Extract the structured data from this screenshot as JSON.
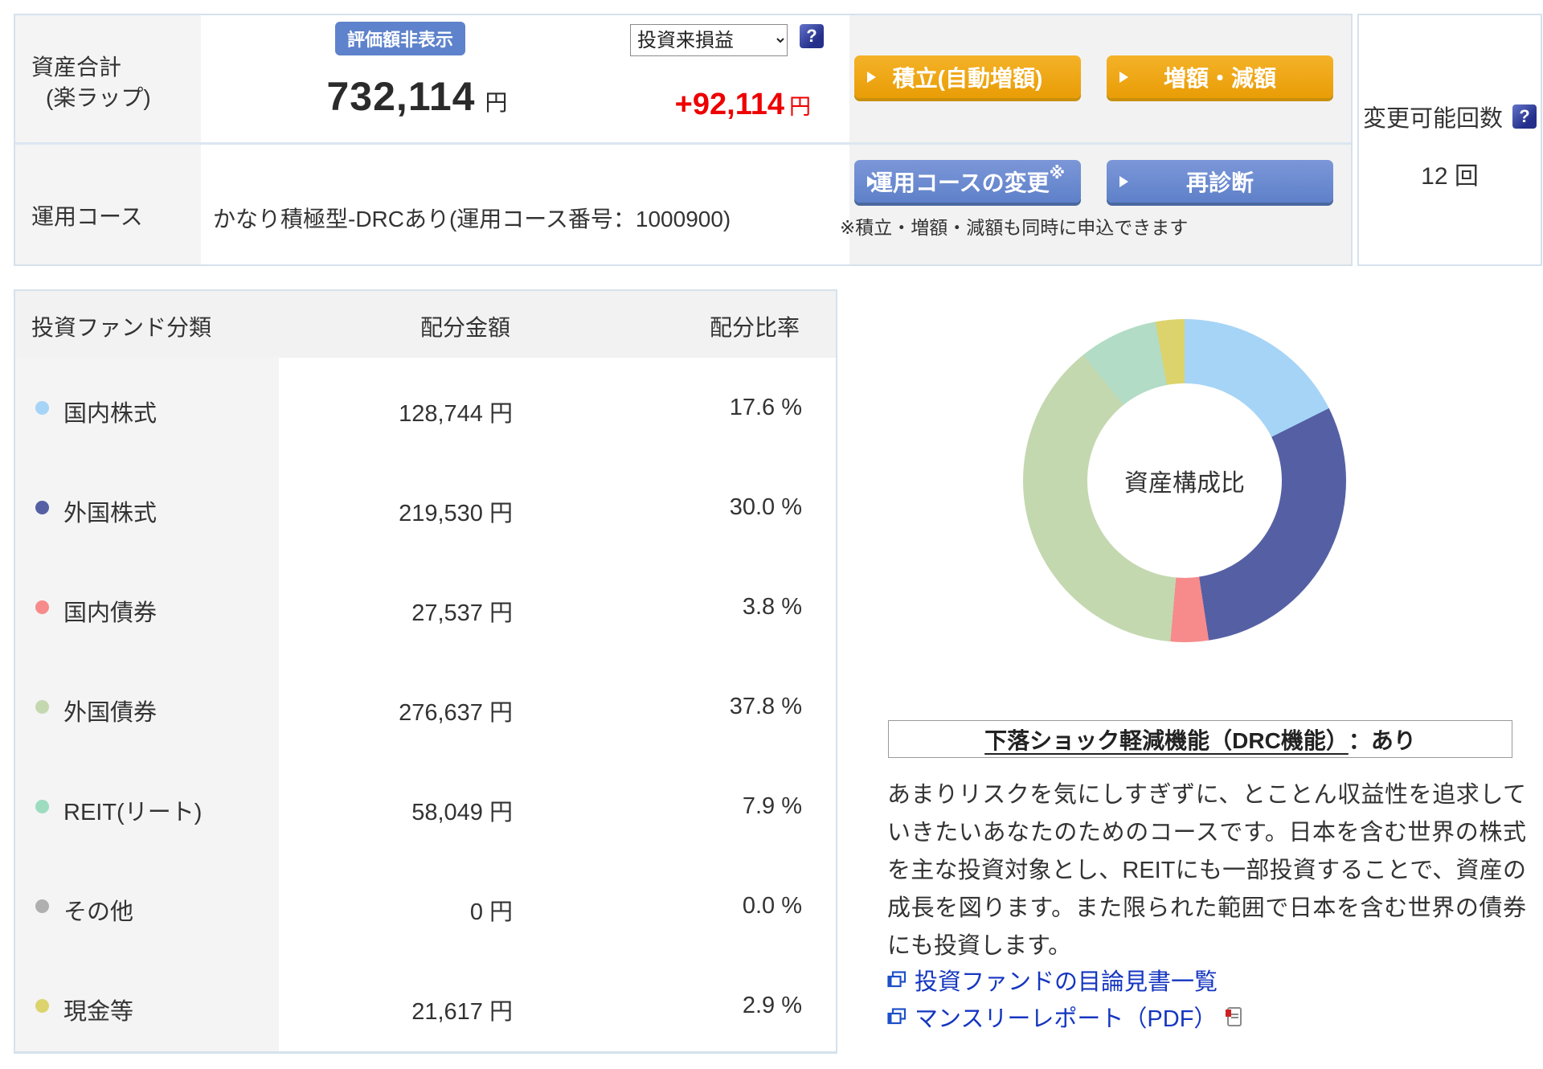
{
  "top_panel": {
    "row1": {
      "label_line1": "資産合計",
      "label_line2": "(楽ラップ)",
      "badge": "評価額非表示",
      "amount": "732,114",
      "amount_unit": "円",
      "dropdown_value": "投資来損益",
      "help_icon": "?",
      "profit": "+92,114",
      "profit_unit": "円",
      "btn_tsumitate": "積立(自動増額)",
      "btn_zougaku": "増額・減額"
    },
    "row2": {
      "label": "運用コース",
      "course": "かなり積極型-DRCあり(運用コース番号：1000900)",
      "btn_change": "運用コースの変更",
      "btn_change_mark": "※",
      "btn_rediagnosis": "再診断",
      "note": "※積立・増額・減額も同時に申込できます"
    }
  },
  "change_panel": {
    "label": "変更可能回数",
    "help_icon": "?",
    "count": "12 回"
  },
  "allocation_table": {
    "headers": {
      "category": "投資ファンド分類",
      "amount": "配分金額",
      "ratio": "配分比率"
    },
    "rows": [
      {
        "label": "国内株式",
        "color": "#a6d4f6",
        "amount": "128,744 円",
        "ratio": "17.6 %"
      },
      {
        "label": "外国株式",
        "color": "#5560a4",
        "amount": "219,530 円",
        "ratio": "30.0 %"
      },
      {
        "label": "国内債券",
        "color": "#f78b8b",
        "amount": "27,537 円",
        "ratio": "3.8 %"
      },
      {
        "label": "外国債券",
        "color": "#c4d8b0",
        "amount": "276,637 円",
        "ratio": "37.8 %"
      },
      {
        "label": "REIT(リート)",
        "color": "#9edcc0",
        "amount": "58,049 円",
        "ratio": "7.9 %"
      },
      {
        "label": "その他",
        "color": "#b0b0b0",
        "amount": "0 円",
        "ratio": "0.0 %"
      },
      {
        "label": "現金等",
        "color": "#dcd36d",
        "amount": "21,617 円",
        "ratio": "2.9 %"
      }
    ]
  },
  "chart_data": {
    "type": "pie",
    "donut": true,
    "title": "資産構成比",
    "categories": [
      "国内株式",
      "外国株式",
      "国内債券",
      "外国債券",
      "REIT(リート)",
      "その他",
      "現金等"
    ],
    "values": [
      17.6,
      30.0,
      3.8,
      37.8,
      7.9,
      0.0,
      2.9
    ],
    "colors": [
      "#a6d4f6",
      "#5560a4",
      "#f78b8b",
      "#c4d8b0",
      "#b2dcc5",
      "#b0b0b0",
      "#dcd36d"
    ],
    "start_angle_deg": 0,
    "direction": "clockwise",
    "legend_position": "none"
  },
  "drc_box": {
    "underlined": "下落ショック軽減機能（DRC機能）",
    "suffix": "：あり"
  },
  "description": "あまりリスクを気にしすぎずに、とことん収益性を追求していきたいあなたのためのコースです。日本を含む世界の株式を主な投資対象とし、REITにも一部投資することで、資産の成長を図ります。また限られた範囲で日本を含む世界の債券にも投資します。",
  "links": {
    "prospectus": "投資ファンドの目論見書一覧",
    "monthly_report": "マンスリーレポート（PDF）"
  }
}
